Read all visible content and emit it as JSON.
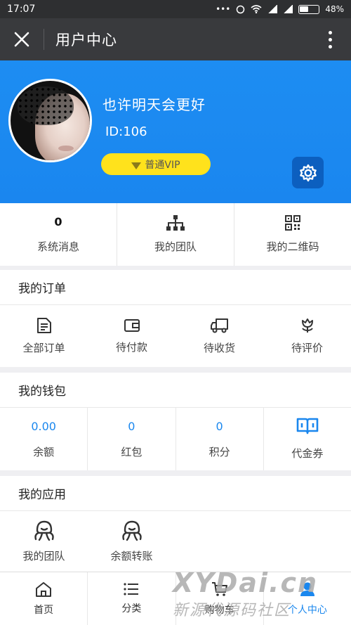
{
  "status_bar": {
    "time": "17:07",
    "signal_dots": "•••",
    "battery": "48%",
    "battery_level": 0.48
  },
  "title_bar": {
    "title": "用户中心"
  },
  "profile": {
    "nickname": "也许明天会更好",
    "user_id": "ID:106",
    "vip_label": "普通VIP"
  },
  "quick_links": [
    {
      "value": "0",
      "label": "系统消息"
    },
    {
      "label": "我的团队",
      "icon": "org-chart-icon"
    },
    {
      "label": "我的二维码",
      "icon": "qrcode-icon"
    }
  ],
  "orders": {
    "title": "我的订单",
    "items": [
      {
        "label": "全部订单",
        "icon": "document-icon"
      },
      {
        "label": "待付款",
        "icon": "wallet-icon"
      },
      {
        "label": "待收货",
        "icon": "truck-icon"
      },
      {
        "label": "待评价",
        "icon": "flower-icon"
      }
    ]
  },
  "wallet": {
    "title": "我的钱包",
    "items": [
      {
        "value": "0.00",
        "label": "余额"
      },
      {
        "value": "0",
        "label": "红包"
      },
      {
        "value": "0",
        "label": "积分"
      },
      {
        "label": "代金券",
        "icon": "book-icon"
      }
    ]
  },
  "apps": {
    "title": "我的应用",
    "items": [
      {
        "label": "我的团队",
        "icon": "octopus-icon"
      },
      {
        "label": "余额转账",
        "icon": "octopus-icon"
      }
    ]
  },
  "tabbar": [
    {
      "label": "首页",
      "icon": "home-icon"
    },
    {
      "label": "分类",
      "icon": "list-icon"
    },
    {
      "label": "购物车",
      "icon": "cart-icon"
    },
    {
      "label": "个人中心",
      "icon": "user-icon",
      "active": true
    }
  ],
  "watermark": {
    "line1": "XYDai.cn",
    "line2": "新源代源码社区"
  },
  "colors": {
    "primary": "#1a87ee",
    "vip": "#ffe21c",
    "titlebar": "#393a3d"
  }
}
